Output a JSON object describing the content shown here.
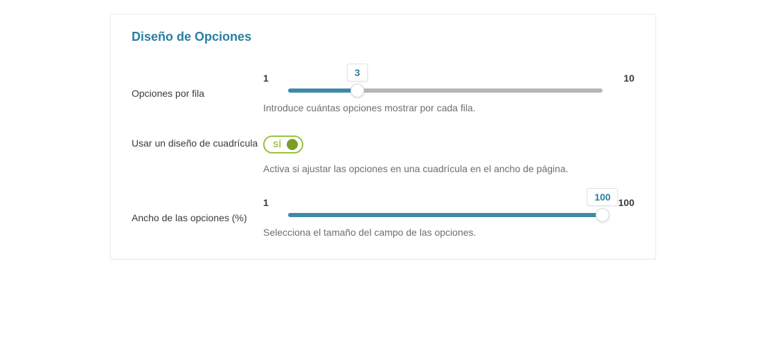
{
  "section": {
    "title": "Diseño de Opciones"
  },
  "rows": {
    "optionsPerRow": {
      "label": "Opciones por fila",
      "min": "1",
      "max": "10",
      "value": "3",
      "help": "Introduce cuántas opciones mostrar por cada fila."
    },
    "gridLayout": {
      "label": "Usar un diseño de cuadrícula",
      "toggleText": "SÍ",
      "help": "Activa si ajustar las opciones en una cuadrícula en el ancho de página."
    },
    "optionsWidth": {
      "label": "Ancho de las opciones (%)",
      "min": "1",
      "max": "100",
      "value": "100",
      "help": "Selecciona el tamaño del campo de las opciones."
    }
  },
  "slider_percents": {
    "row1": 22,
    "row3": 100
  }
}
